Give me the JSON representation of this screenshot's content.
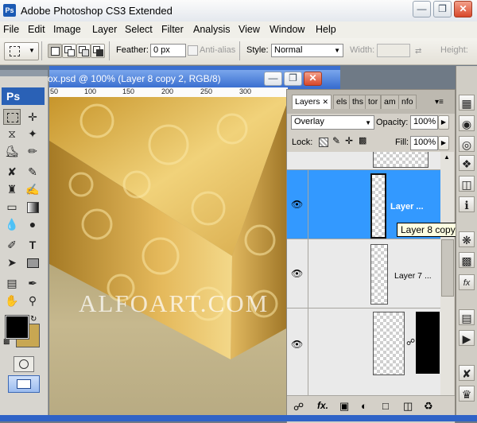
{
  "window": {
    "title": "Adobe Photoshop CS3 Extended",
    "app_icon": "Ps"
  },
  "menu": [
    "File",
    "Edit",
    "Image",
    "Layer",
    "Select",
    "Filter",
    "Analysis",
    "View",
    "Window",
    "Help"
  ],
  "options": {
    "feather_label": "Feather:",
    "feather_value": "0 px",
    "antialias_label": "Anti-alias",
    "style_label": "Style:",
    "style_value": "Normal",
    "width_label": "Width:",
    "height_label": "Height:"
  },
  "toolbox": {
    "logo": "Ps"
  },
  "document": {
    "title": "ox.psd @ 100% (Layer 8 copy 2, RGB/8)",
    "ruler_ticks": [
      "50",
      "100",
      "150",
      "200",
      "250",
      "300"
    ],
    "watermark": "ALFOART.COM"
  },
  "layers_panel": {
    "tabs": [
      "Layers",
      "els",
      "ths",
      "tor",
      "am",
      "nfo"
    ],
    "blend_mode": "Overlay",
    "opacity_label": "Opacity:",
    "opacity_value": "100%",
    "lock_label": "Lock:",
    "fill_label": "Fill:",
    "fill_value": "100%",
    "layers": [
      {
        "name": "Layer ...",
        "selected": true
      },
      {
        "name": "Layer 7 ...",
        "selected": false
      },
      {
        "name": "",
        "selected": false
      }
    ],
    "tooltip": "Layer 8 copy 2"
  },
  "colors": {
    "selection": "#3399ff",
    "foreground": "#000000",
    "background": "#c8a752"
  }
}
